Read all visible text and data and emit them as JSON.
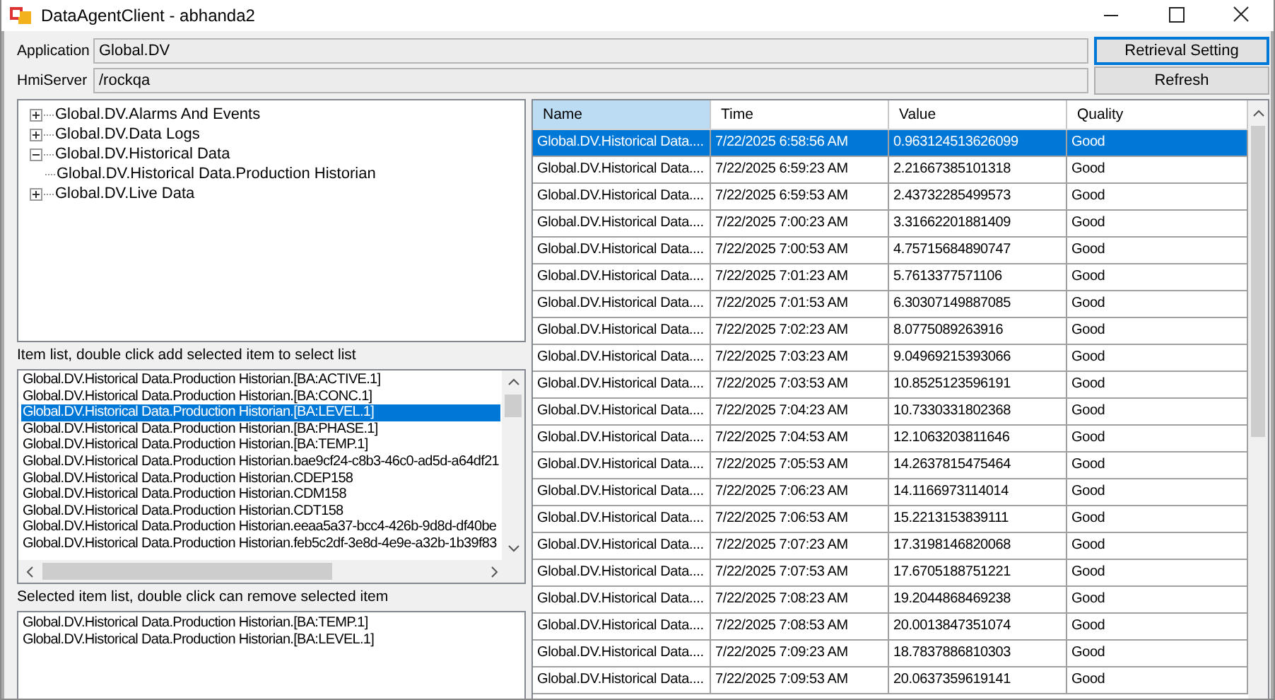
{
  "window": {
    "title": "DataAgentClient - abhanda2"
  },
  "fields": [
    {
      "label": "Application",
      "value": "Global.DV"
    },
    {
      "label": "HmiServer",
      "value": "/rockqa"
    }
  ],
  "buttons": [
    "Retrieval Setting",
    "Refresh"
  ],
  "tree": [
    {
      "label": "Global.DV.Alarms And Events",
      "expanded": false
    },
    {
      "label": "Global.DV.Data Logs",
      "expanded": false
    },
    {
      "label": "Global.DV.Historical Data",
      "expanded": true,
      "children": [
        {
          "label": "Global.DV.Historical Data.Production Historian"
        }
      ]
    },
    {
      "label": "Global.DV.Live Data",
      "expanded": false
    }
  ],
  "item_list": {
    "caption": "Item list, double click add selected item to select list",
    "items": [
      {
        "label": "Global.DV.Historical Data.Production Historian.[BA:ACTIVE.1]",
        "selected": false
      },
      {
        "label": "Global.DV.Historical Data.Production Historian.[BA:CONC.1]",
        "selected": false
      },
      {
        "label": "Global.DV.Historical Data.Production Historian.[BA:LEVEL.1]",
        "selected": true
      },
      {
        "label": "Global.DV.Historical Data.Production Historian.[BA:PHASE.1]",
        "selected": false
      },
      {
        "label": "Global.DV.Historical Data.Production Historian.[BA:TEMP.1]",
        "selected": false
      },
      {
        "label": "Global.DV.Historical Data.Production Historian.bae9cf24-c8b3-46c0-ad5d-a64df21",
        "selected": false
      },
      {
        "label": "Global.DV.Historical Data.Production Historian.CDEP158",
        "selected": false
      },
      {
        "label": "Global.DV.Historical Data.Production Historian.CDM158",
        "selected": false
      },
      {
        "label": "Global.DV.Historical Data.Production Historian.CDT158",
        "selected": false
      },
      {
        "label": "Global.DV.Historical Data.Production Historian.eeaa5a37-bcc4-426b-9d8d-df40be",
        "selected": false
      },
      {
        "label": "Global.DV.Historical Data.Production Historian.feb5c2df-3e8d-4e9e-a32b-1b39f83",
        "selected": false
      }
    ]
  },
  "selected_list": {
    "caption": "Selected item list, double click can remove selected item",
    "items": [
      "Global.DV.Historical Data.Production Historian.[BA:TEMP.1]",
      "Global.DV.Historical Data.Production Historian.[BA:LEVEL.1]"
    ]
  },
  "table": {
    "columns": [
      {
        "label": "Name",
        "selected": true
      },
      {
        "label": "Time",
        "selected": false
      },
      {
        "label": "Value",
        "selected": false
      },
      {
        "label": "Quality",
        "selected": false
      }
    ],
    "rows": [
      {
        "cells": [
          "Global.DV.Historical Data....",
          "7/22/2025 6:58:56 AM",
          "0.963124513626099",
          "Good"
        ],
        "selected": true
      },
      {
        "cells": [
          "Global.DV.Historical Data....",
          "7/22/2025 6:59:23 AM",
          "2.21667385101318",
          "Good"
        ],
        "selected": false
      },
      {
        "cells": [
          "Global.DV.Historical Data....",
          "7/22/2025 6:59:53 AM",
          "2.43732285499573",
          "Good"
        ],
        "selected": false
      },
      {
        "cells": [
          "Global.DV.Historical Data....",
          "7/22/2025 7:00:23 AM",
          "3.31662201881409",
          "Good"
        ],
        "selected": false
      },
      {
        "cells": [
          "Global.DV.Historical Data....",
          "7/22/2025 7:00:53 AM",
          "4.75715684890747",
          "Good"
        ],
        "selected": false
      },
      {
        "cells": [
          "Global.DV.Historical Data....",
          "7/22/2025 7:01:23 AM",
          "5.7613377571106",
          "Good"
        ],
        "selected": false
      },
      {
        "cells": [
          "Global.DV.Historical Data....",
          "7/22/2025 7:01:53 AM",
          "6.30307149887085",
          "Good"
        ],
        "selected": false
      },
      {
        "cells": [
          "Global.DV.Historical Data....",
          "7/22/2025 7:02:23 AM",
          "8.0775089263916",
          "Good"
        ],
        "selected": false
      },
      {
        "cells": [
          "Global.DV.Historical Data....",
          "7/22/2025 7:03:23 AM",
          "9.04969215393066",
          "Good"
        ],
        "selected": false
      },
      {
        "cells": [
          "Global.DV.Historical Data....",
          "7/22/2025 7:03:53 AM",
          "10.8525123596191",
          "Good"
        ],
        "selected": false
      },
      {
        "cells": [
          "Global.DV.Historical Data....",
          "7/22/2025 7:04:23 AM",
          "10.7330331802368",
          "Good"
        ],
        "selected": false
      },
      {
        "cells": [
          "Global.DV.Historical Data....",
          "7/22/2025 7:04:53 AM",
          "12.1063203811646",
          "Good"
        ],
        "selected": false
      },
      {
        "cells": [
          "Global.DV.Historical Data....",
          "7/22/2025 7:05:53 AM",
          "14.2637815475464",
          "Good"
        ],
        "selected": false
      },
      {
        "cells": [
          "Global.DV.Historical Data....",
          "7/22/2025 7:06:23 AM",
          "14.1166973114014",
          "Good"
        ],
        "selected": false
      },
      {
        "cells": [
          "Global.DV.Historical Data....",
          "7/22/2025 7:06:53 AM",
          "15.2213153839111",
          "Good"
        ],
        "selected": false
      },
      {
        "cells": [
          "Global.DV.Historical Data....",
          "7/22/2025 7:07:23 AM",
          "17.3198146820068",
          "Good"
        ],
        "selected": false
      },
      {
        "cells": [
          "Global.DV.Historical Data....",
          "7/22/2025 7:07:53 AM",
          "17.6705188751221",
          "Good"
        ],
        "selected": false
      },
      {
        "cells": [
          "Global.DV.Historical Data....",
          "7/22/2025 7:08:23 AM",
          "19.2044868469238",
          "Good"
        ],
        "selected": false
      },
      {
        "cells": [
          "Global.DV.Historical Data....",
          "7/22/2025 7:08:53 AM",
          "20.0013847351074",
          "Good"
        ],
        "selected": false
      },
      {
        "cells": [
          "Global.DV.Historical Data....",
          "7/22/2025 7:09:23 AM",
          "18.7837886810303",
          "Good"
        ],
        "selected": false
      },
      {
        "cells": [
          "Global.DV.Historical Data....",
          "7/22/2025 7:09:53 AM",
          "20.0637359619141",
          "Good"
        ],
        "selected": false
      }
    ]
  }
}
